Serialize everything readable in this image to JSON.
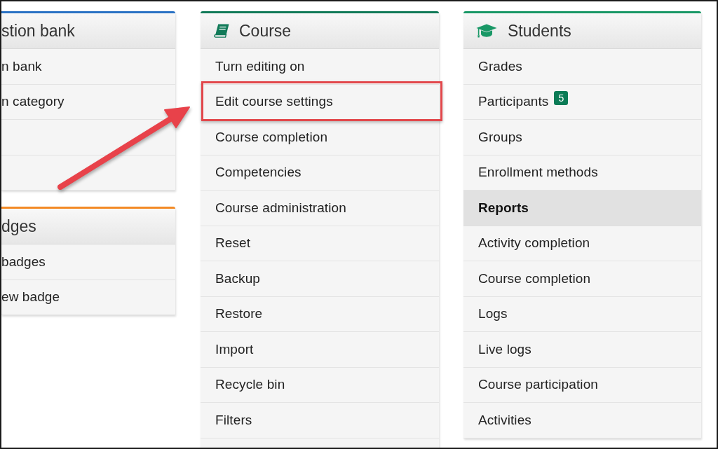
{
  "columns": [
    {
      "cards": [
        {
          "kind": "plain",
          "title": "stion bank",
          "color": "#2a72c4",
          "items": [
            {
              "kind": "link",
              "label": "n bank",
              "highlighted": false
            },
            {
              "kind": "link",
              "label": "n category",
              "highlighted": false
            },
            {
              "kind": "link",
              "highlighted": false
            },
            {
              "kind": "link",
              "highlighted": false
            }
          ]
        },
        {
          "kind": "plain",
          "title": "dges",
          "color": "#f38a25",
          "items": [
            {
              "kind": "link",
              "label": "badges",
              "highlighted": false
            },
            {
              "kind": "link",
              "label": "ew badge",
              "highlighted": false
            }
          ]
        }
      ]
    },
    {
      "cards": [
        {
          "kind": "course",
          "title": "Course",
          "color": "#117a58",
          "items": [
            {
              "kind": "link",
              "label": "Turn editing on",
              "highlighted": false
            },
            {
              "kind": "link",
              "label": "Edit course settings",
              "highlighted": true
            },
            {
              "kind": "link",
              "label": "Course completion",
              "highlighted": false
            },
            {
              "kind": "link",
              "label": "Competencies",
              "highlighted": false
            },
            {
              "kind": "link",
              "label": "Course administration",
              "highlighted": false
            },
            {
              "kind": "link",
              "label": "Reset",
              "highlighted": false
            },
            {
              "kind": "link",
              "label": "Backup",
              "highlighted": false
            },
            {
              "kind": "link",
              "label": "Restore",
              "highlighted": false
            },
            {
              "kind": "link",
              "label": "Import",
              "highlighted": false
            },
            {
              "kind": "link",
              "label": "Recycle bin",
              "highlighted": false
            },
            {
              "kind": "link",
              "label": "Filters",
              "highlighted": false
            }
          ]
        }
      ]
    },
    {
      "cards": [
        {
          "kind": "students",
          "title": "Students",
          "color": "#199866",
          "items": [
            {
              "kind": "link",
              "label": "Grades",
              "highlighted": false
            },
            {
              "kind": "link",
              "label": "Participants",
              "badge": "5",
              "highlighted": false
            },
            {
              "kind": "link",
              "label": "Groups",
              "highlighted": false
            },
            {
              "kind": "link",
              "label": "Enrollment methods",
              "highlighted": false
            },
            {
              "kind": "heading",
              "label": "Reports",
              "highlighted": false
            },
            {
              "kind": "link",
              "label": "Activity completion",
              "highlighted": false
            },
            {
              "kind": "link",
              "label": "Course completion",
              "highlighted": false
            },
            {
              "kind": "link",
              "label": "Logs",
              "highlighted": false
            },
            {
              "kind": "link",
              "label": "Live logs",
              "highlighted": false
            },
            {
              "kind": "link",
              "label": "Course participation",
              "highlighted": false
            },
            {
              "kind": "link",
              "label": "Activities",
              "highlighted": false
            }
          ]
        }
      ]
    }
  ],
  "callout_arrow": true
}
